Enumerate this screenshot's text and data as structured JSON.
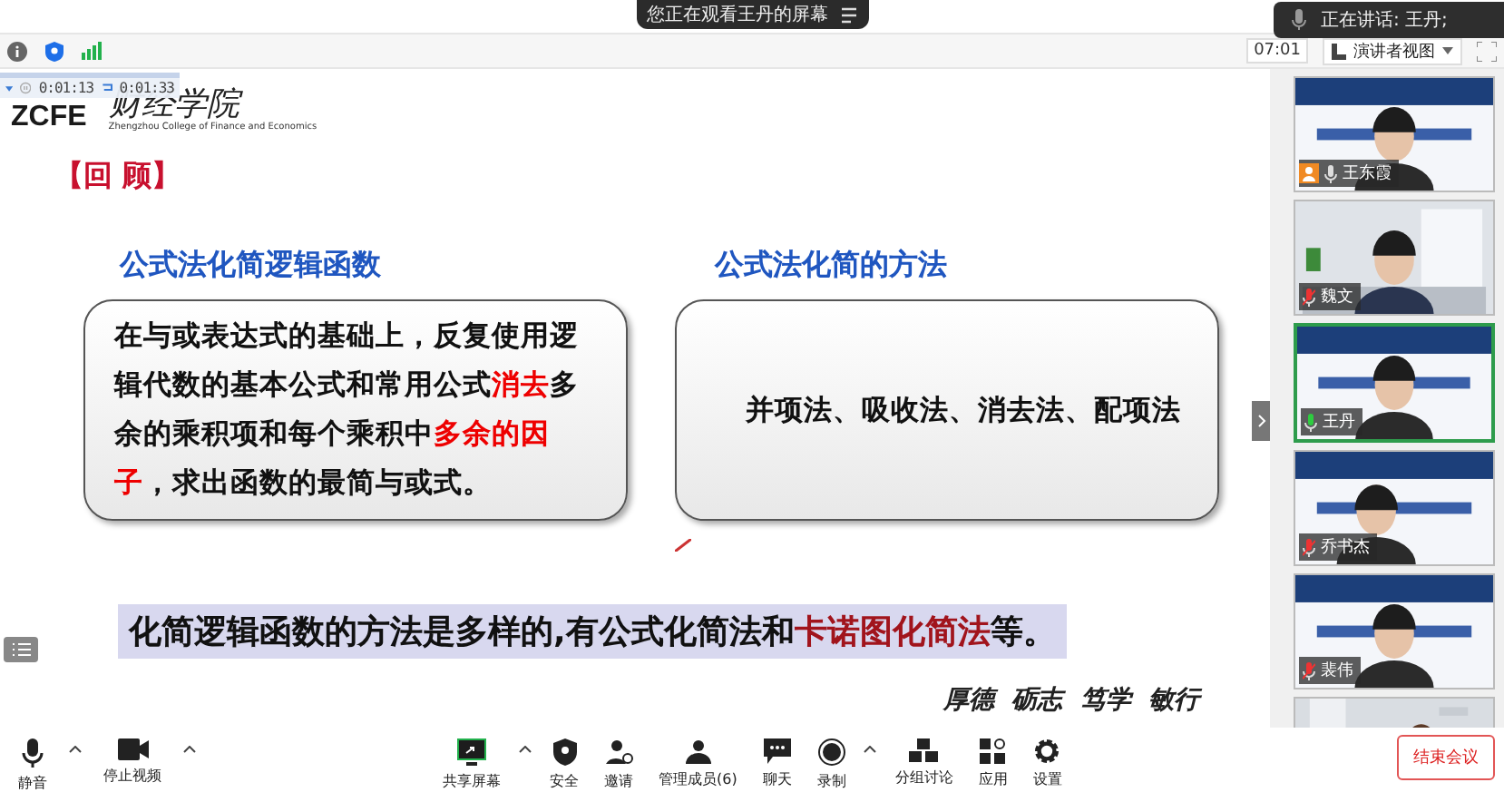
{
  "banner": {
    "text": "您正在观看王丹的屏幕"
  },
  "speaking": {
    "text": "正在讲话: 王丹;"
  },
  "recording": {
    "elapsed": "0:01:13",
    "total": "0:01:33"
  },
  "toolbar": {
    "time": "07:01",
    "view": "演讲者视图"
  },
  "slide": {
    "logo": "ZCFE",
    "school": "财经学院",
    "school_en": "Zhengzhou College of Finance and Economics",
    "section": "【回 顾】",
    "columns": [
      {
        "heading": "公式法化简逻辑函数",
        "segments": [
          {
            "text": "在与或表达式的基础上，反复使用逻辑代数的基本公式和常用公式",
            "highlight": false
          },
          {
            "text": "消去",
            "highlight": true
          },
          {
            "text": "多余的乘积项和每个乘积中",
            "highlight": false
          },
          {
            "text": "多余的因子",
            "highlight": true
          },
          {
            "text": "，求出函数的最简与或式。",
            "highlight": false
          }
        ]
      },
      {
        "heading": "公式法化简的方法",
        "segments": [
          {
            "text": "并项法、吸收法、消去法、配项法",
            "highlight": false
          }
        ]
      }
    ],
    "summary": [
      {
        "text": "化简逻辑函数的方法是多样的,有公式化简法和",
        "highlight": false
      },
      {
        "text": "卡诺图化简法",
        "highlight": true
      },
      {
        "text": "等。",
        "highlight": false
      }
    ],
    "motto": "厚德  砺志  笃学  敏行"
  },
  "participants": [
    {
      "name": "王东霞",
      "muted": false,
      "speaking": false,
      "host": true,
      "selected": false
    },
    {
      "name": "魏文",
      "muted": true,
      "speaking": false,
      "host": false,
      "selected": false
    },
    {
      "name": "王丹",
      "muted": false,
      "speaking": true,
      "host": false,
      "selected": true
    },
    {
      "name": "乔书杰",
      "muted": true,
      "speaking": false,
      "host": false,
      "selected": false
    },
    {
      "name": "裴伟",
      "muted": true,
      "speaking": false,
      "host": false,
      "selected": false
    }
  ],
  "controls_left": [
    {
      "label": "静音",
      "kind": "mic",
      "menu": true
    },
    {
      "label": "停止视频",
      "kind": "camera",
      "menu": true
    }
  ],
  "controls_center": [
    {
      "label": "共享屏幕",
      "kind": "share",
      "menu": true
    },
    {
      "label": "安全",
      "kind": "shield",
      "menu": false
    },
    {
      "label": "邀请",
      "kind": "invite",
      "menu": false
    },
    {
      "label": "管理成员(6)",
      "kind": "members",
      "menu": false
    },
    {
      "label": "聊天",
      "kind": "chat",
      "menu": false
    },
    {
      "label": "录制",
      "kind": "record",
      "menu": true
    },
    {
      "label": "分组讨论",
      "kind": "groups",
      "menu": false
    },
    {
      "label": "应用",
      "kind": "apps",
      "menu": false
    },
    {
      "label": "设置",
      "kind": "gear",
      "menu": false
    }
  ],
  "end_button": "结束会议"
}
